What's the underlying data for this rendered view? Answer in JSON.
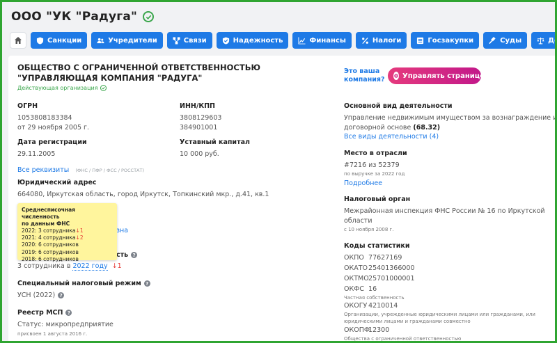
{
  "company": {
    "title": "ООО \"УК \"Радуга\"",
    "full_name": "ОБЩЕСТВО С ОГРАНИЧЕННОЙ ОТВЕТСТВЕННОСТЬЮ \"УПРАВЛЯЮЩАЯ КОМПАНИЯ \"РАДУГА\"",
    "status": "Действующая организация"
  },
  "tabs": [
    {
      "label": "Санкции",
      "icon": "shield-dollar-icon"
    },
    {
      "label": "Учредители",
      "icon": "users-icon"
    },
    {
      "label": "Связи",
      "icon": "network-icon"
    },
    {
      "label": "Надежность",
      "icon": "shield-check-icon"
    },
    {
      "label": "Финансы",
      "icon": "chart-icon"
    },
    {
      "label": "Налоги",
      "icon": "percent-icon"
    },
    {
      "label": "Госзакупки",
      "icon": "catalog-icon"
    },
    {
      "label": "Суды",
      "icon": "gavel-icon"
    },
    {
      "label": "Долги",
      "icon": "scales-icon"
    }
  ],
  "ogrn": {
    "label": "ОГРН",
    "value": "1053808183384",
    "date": "от 29 ноября 2005 г."
  },
  "inn": {
    "label": "ИНН/КПП",
    "value": "3808129603",
    "kpp": "384901001"
  },
  "reg": {
    "label": "Дата регистрации",
    "value": "29.11.2005"
  },
  "capital": {
    "label": "Уставный капитал",
    "value": "10 000 руб."
  },
  "requisites": {
    "link": "Все реквизиты",
    "sources": "(ФНС / ПФР / ФСС / РОССТАТ)"
  },
  "address": {
    "label": "Юридический адрес",
    "value": "664080, Иркутская область, город Иркутск, Топкинский мкр., д.41, кв.1"
  },
  "tooltip": {
    "head1": "Среднесписочная численность",
    "head2": "по данным ФНС",
    "rows": [
      {
        "text": "2022: 3 сотрудника",
        "delta": "↓1"
      },
      {
        "text": "2021: 4 сотрудника",
        "delta": "↓2"
      },
      {
        "text": "2020: 6 сотрудников",
        "delta": ""
      },
      {
        "text": "2019: 6 сотрудников",
        "delta": ""
      },
      {
        "text": "2018: 6 сотрудников",
        "delta": ""
      }
    ]
  },
  "hidden_fragments": {
    "link_tail": "зна",
    "label_tail": "сть"
  },
  "employees": {
    "prefix": "3 сотрудника в",
    "year_link": "2022 году",
    "delta": "↓1"
  },
  "tax_regime": {
    "label": "Специальный налоговый режим",
    "value": "УСН (2022)"
  },
  "msp": {
    "label": "Реестр МСП",
    "status": "Статус: микропредприятие",
    "since": "присвоен 1 августа 2016 г."
  },
  "owner": {
    "question": "Это ваша компания?",
    "button": "Управлять страницей"
  },
  "activity": {
    "label": "Основной вид деятельности",
    "line1": "Управление недвижимым имуществом за вознаграждение или на",
    "line2": "договорной основе",
    "code": "(68.32)",
    "link": "Все виды деятельности (4)"
  },
  "rank": {
    "label": "Место в отрасли",
    "value": "#7216 из 52379",
    "note": "по выручке за 2022 год",
    "link": "Подробнее"
  },
  "tax_office": {
    "label": "Налоговый орган",
    "line1": "Межрайонная инспекция ФНС России № 16 по Иркутской",
    "line2": "области",
    "since": "с 10 ноября 2008 г."
  },
  "stats": {
    "label": "Коды статистики",
    "okpo": {
      "k": "ОКПО",
      "v": "77627169"
    },
    "okato": {
      "k": "ОКАТО",
      "v": "25401366000"
    },
    "oktmo": {
      "k": "ОКТМО",
      "v": "25701000001"
    },
    "okfs": {
      "k": "ОКФС",
      "v": "16",
      "note": "Частная собственность"
    },
    "okogu": {
      "k": "ОКОГУ",
      "v": "4210014",
      "note1": "Организации, учрежденные юридическими лицами или гражданами, или",
      "note2": "юридическими лицами и гражданами совместно"
    },
    "okopf": {
      "k": "ОКОПФ",
      "v": "12300",
      "note": "Общества с ограниченной ответственностью"
    }
  }
}
